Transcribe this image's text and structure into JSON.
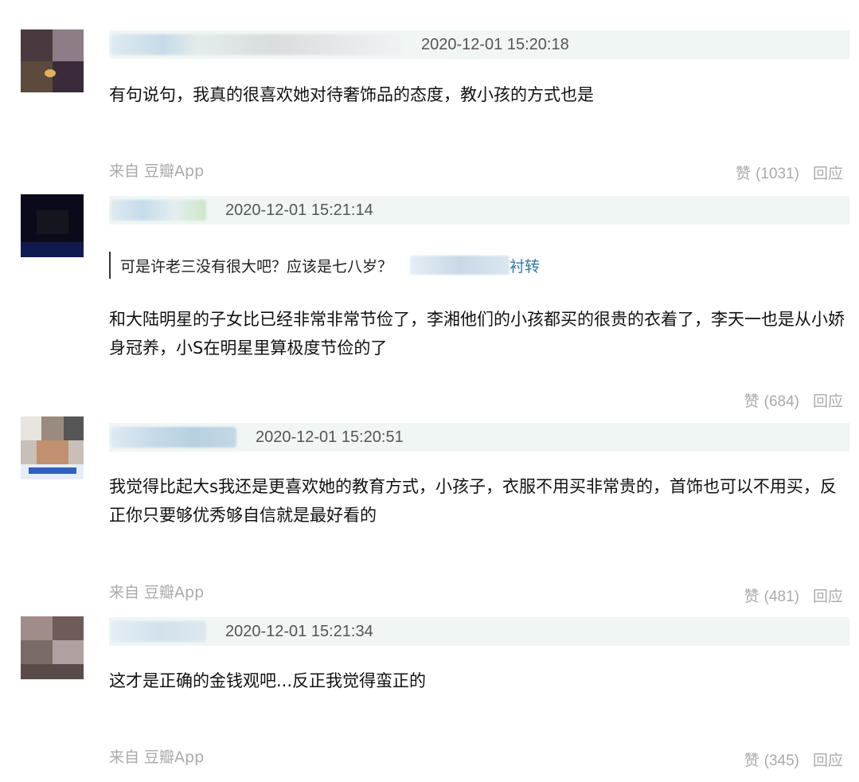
{
  "comments": [
    {
      "time": "2020-12-01 15:20:18",
      "text": "有句说句，我真的很喜欢她对待奢饰品的态度，教小孩的方式也是",
      "source": "来自 豆瓣App",
      "like_label": "赞",
      "like_count": "(1031)",
      "reply_label": "回应"
    },
    {
      "time": "2020-12-01 15:21:14",
      "quote_text": "可是许老三没有很大吧？应该是七八岁？",
      "quote_link": "衬转",
      "text": "和大陆明星的子女比已经非常非常节俭了，李湘他们的小孩都买的很贵的衣着了，李天一也是从小娇身冠养，小S在明星里算极度节俭的了",
      "like_label": "赞",
      "like_count": "(684)",
      "reply_label": "回应"
    },
    {
      "time": "2020-12-01 15:20:51",
      "text": "我觉得比起大s我还是更喜欢她的教育方式，小孩子，衣服不用买非常贵的，首饰也可以不用买，反正你只要够优秀够自信就是最好看的",
      "source": "来自 豆瓣App",
      "like_label": "赞",
      "like_count": "(481)",
      "reply_label": "回应"
    },
    {
      "time": "2020-12-01 15:21:34",
      "text": "这才是正确的金钱观吧...反正我觉得蛮正的",
      "source": "来自 豆瓣App",
      "like_label": "赞",
      "like_count": "(345)",
      "reply_label": "回应"
    }
  ]
}
